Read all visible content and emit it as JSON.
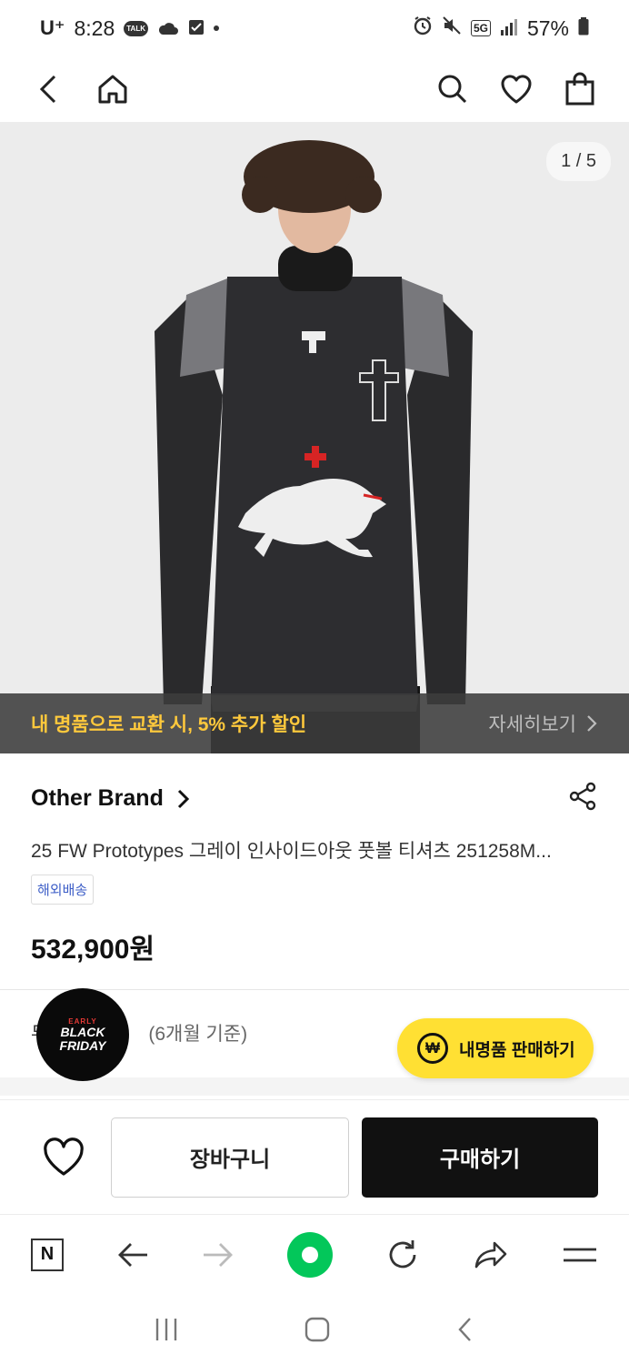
{
  "status": {
    "carrier": "U⁺",
    "time": "8:28",
    "talk_badge": "TALK",
    "network": "5G",
    "battery": "57%"
  },
  "header": {
    "icons": [
      "back-icon",
      "home-icon",
      "search-icon",
      "heart-icon",
      "shopping-bag-icon"
    ]
  },
  "gallery": {
    "counter": "1 / 5"
  },
  "promo": {
    "text": "내 명품으로 교환 시, 5% 추가 할인",
    "link": "자세히보기"
  },
  "product": {
    "brand": "Other Brand",
    "name": "25 FW Prototypes 그레이 인사이드아웃 풋볼 티셔츠 251258M...",
    "shipping_tag": "해외배송",
    "price": "532,900원"
  },
  "installment": {
    "prefix": "무",
    "months": "(6개월 기준)"
  },
  "black_friday_badge": {
    "early": "EARLY",
    "line1": "BLACK",
    "line2": "FRIDAY"
  },
  "sell_button": {
    "icon_glyph": "₩",
    "label": "내명품 판매하기"
  },
  "actions": {
    "cart": "장바구니",
    "buy": "구매하기"
  },
  "browser": {
    "n_label": "N"
  },
  "colors": {
    "accent_yellow": "#ffe033",
    "promo_text": "#ffc93c",
    "naver_green": "#03c75a"
  }
}
